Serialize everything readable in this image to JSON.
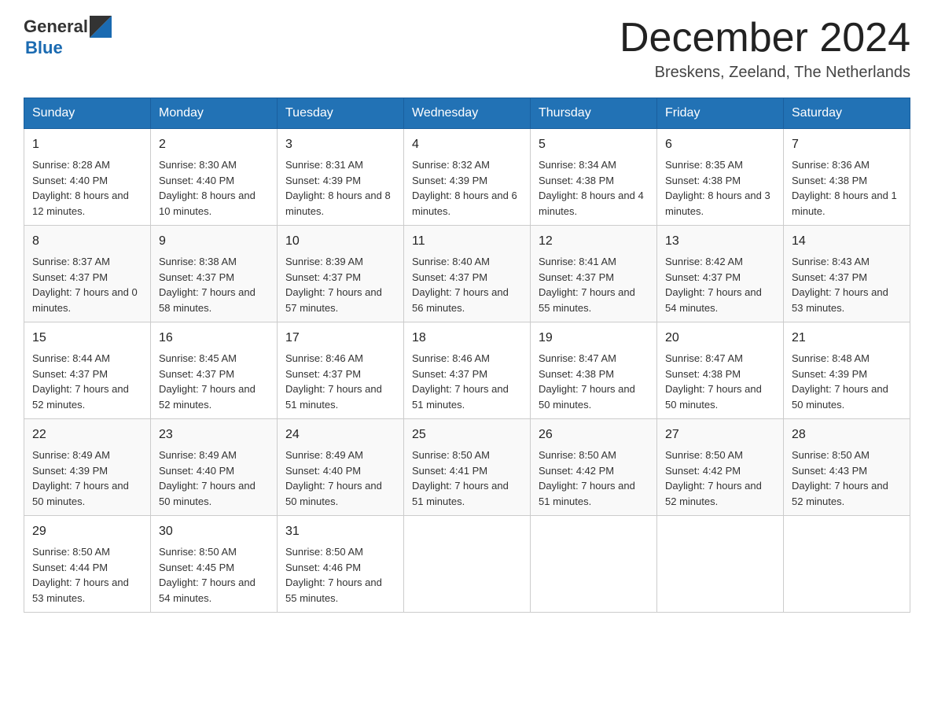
{
  "header": {
    "logo_general": "General",
    "logo_blue": "Blue",
    "title": "December 2024",
    "subtitle": "Breskens, Zeeland, The Netherlands"
  },
  "calendar": {
    "days": [
      "Sunday",
      "Monday",
      "Tuesday",
      "Wednesday",
      "Thursday",
      "Friday",
      "Saturday"
    ],
    "weeks": [
      [
        {
          "day": "1",
          "sunrise": "8:28 AM",
          "sunset": "4:40 PM",
          "daylight": "8 hours and 12 minutes."
        },
        {
          "day": "2",
          "sunrise": "8:30 AM",
          "sunset": "4:40 PM",
          "daylight": "8 hours and 10 minutes."
        },
        {
          "day": "3",
          "sunrise": "8:31 AM",
          "sunset": "4:39 PM",
          "daylight": "8 hours and 8 minutes."
        },
        {
          "day": "4",
          "sunrise": "8:32 AM",
          "sunset": "4:39 PM",
          "daylight": "8 hours and 6 minutes."
        },
        {
          "day": "5",
          "sunrise": "8:34 AM",
          "sunset": "4:38 PM",
          "daylight": "8 hours and 4 minutes."
        },
        {
          "day": "6",
          "sunrise": "8:35 AM",
          "sunset": "4:38 PM",
          "daylight": "8 hours and 3 minutes."
        },
        {
          "day": "7",
          "sunrise": "8:36 AM",
          "sunset": "4:38 PM",
          "daylight": "8 hours and 1 minute."
        }
      ],
      [
        {
          "day": "8",
          "sunrise": "8:37 AM",
          "sunset": "4:37 PM",
          "daylight": "7 hours and 0 minutes."
        },
        {
          "day": "9",
          "sunrise": "8:38 AM",
          "sunset": "4:37 PM",
          "daylight": "7 hours and 58 minutes."
        },
        {
          "day": "10",
          "sunrise": "8:39 AM",
          "sunset": "4:37 PM",
          "daylight": "7 hours and 57 minutes."
        },
        {
          "day": "11",
          "sunrise": "8:40 AM",
          "sunset": "4:37 PM",
          "daylight": "7 hours and 56 minutes."
        },
        {
          "day": "12",
          "sunrise": "8:41 AM",
          "sunset": "4:37 PM",
          "daylight": "7 hours and 55 minutes."
        },
        {
          "day": "13",
          "sunrise": "8:42 AM",
          "sunset": "4:37 PM",
          "daylight": "7 hours and 54 minutes."
        },
        {
          "day": "14",
          "sunrise": "8:43 AM",
          "sunset": "4:37 PM",
          "daylight": "7 hours and 53 minutes."
        }
      ],
      [
        {
          "day": "15",
          "sunrise": "8:44 AM",
          "sunset": "4:37 PM",
          "daylight": "7 hours and 52 minutes."
        },
        {
          "day": "16",
          "sunrise": "8:45 AM",
          "sunset": "4:37 PM",
          "daylight": "7 hours and 52 minutes."
        },
        {
          "day": "17",
          "sunrise": "8:46 AM",
          "sunset": "4:37 PM",
          "daylight": "7 hours and 51 minutes."
        },
        {
          "day": "18",
          "sunrise": "8:46 AM",
          "sunset": "4:37 PM",
          "daylight": "7 hours and 51 minutes."
        },
        {
          "day": "19",
          "sunrise": "8:47 AM",
          "sunset": "4:38 PM",
          "daylight": "7 hours and 50 minutes."
        },
        {
          "day": "20",
          "sunrise": "8:47 AM",
          "sunset": "4:38 PM",
          "daylight": "7 hours and 50 minutes."
        },
        {
          "day": "21",
          "sunrise": "8:48 AM",
          "sunset": "4:39 PM",
          "daylight": "7 hours and 50 minutes."
        }
      ],
      [
        {
          "day": "22",
          "sunrise": "8:49 AM",
          "sunset": "4:39 PM",
          "daylight": "7 hours and 50 minutes."
        },
        {
          "day": "23",
          "sunrise": "8:49 AM",
          "sunset": "4:40 PM",
          "daylight": "7 hours and 50 minutes."
        },
        {
          "day": "24",
          "sunrise": "8:49 AM",
          "sunset": "4:40 PM",
          "daylight": "7 hours and 50 minutes."
        },
        {
          "day": "25",
          "sunrise": "8:50 AM",
          "sunset": "4:41 PM",
          "daylight": "7 hours and 51 minutes."
        },
        {
          "day": "26",
          "sunrise": "8:50 AM",
          "sunset": "4:42 PM",
          "daylight": "7 hours and 51 minutes."
        },
        {
          "day": "27",
          "sunrise": "8:50 AM",
          "sunset": "4:42 PM",
          "daylight": "7 hours and 52 minutes."
        },
        {
          "day": "28",
          "sunrise": "8:50 AM",
          "sunset": "4:43 PM",
          "daylight": "7 hours and 52 minutes."
        }
      ],
      [
        {
          "day": "29",
          "sunrise": "8:50 AM",
          "sunset": "4:44 PM",
          "daylight": "7 hours and 53 minutes."
        },
        {
          "day": "30",
          "sunrise": "8:50 AM",
          "sunset": "4:45 PM",
          "daylight": "7 hours and 54 minutes."
        },
        {
          "day": "31",
          "sunrise": "8:50 AM",
          "sunset": "4:46 PM",
          "daylight": "7 hours and 55 minutes."
        },
        null,
        null,
        null,
        null
      ]
    ],
    "labels": {
      "sunrise": "Sunrise: ",
      "sunset": "Sunset: ",
      "daylight": "Daylight: "
    }
  }
}
